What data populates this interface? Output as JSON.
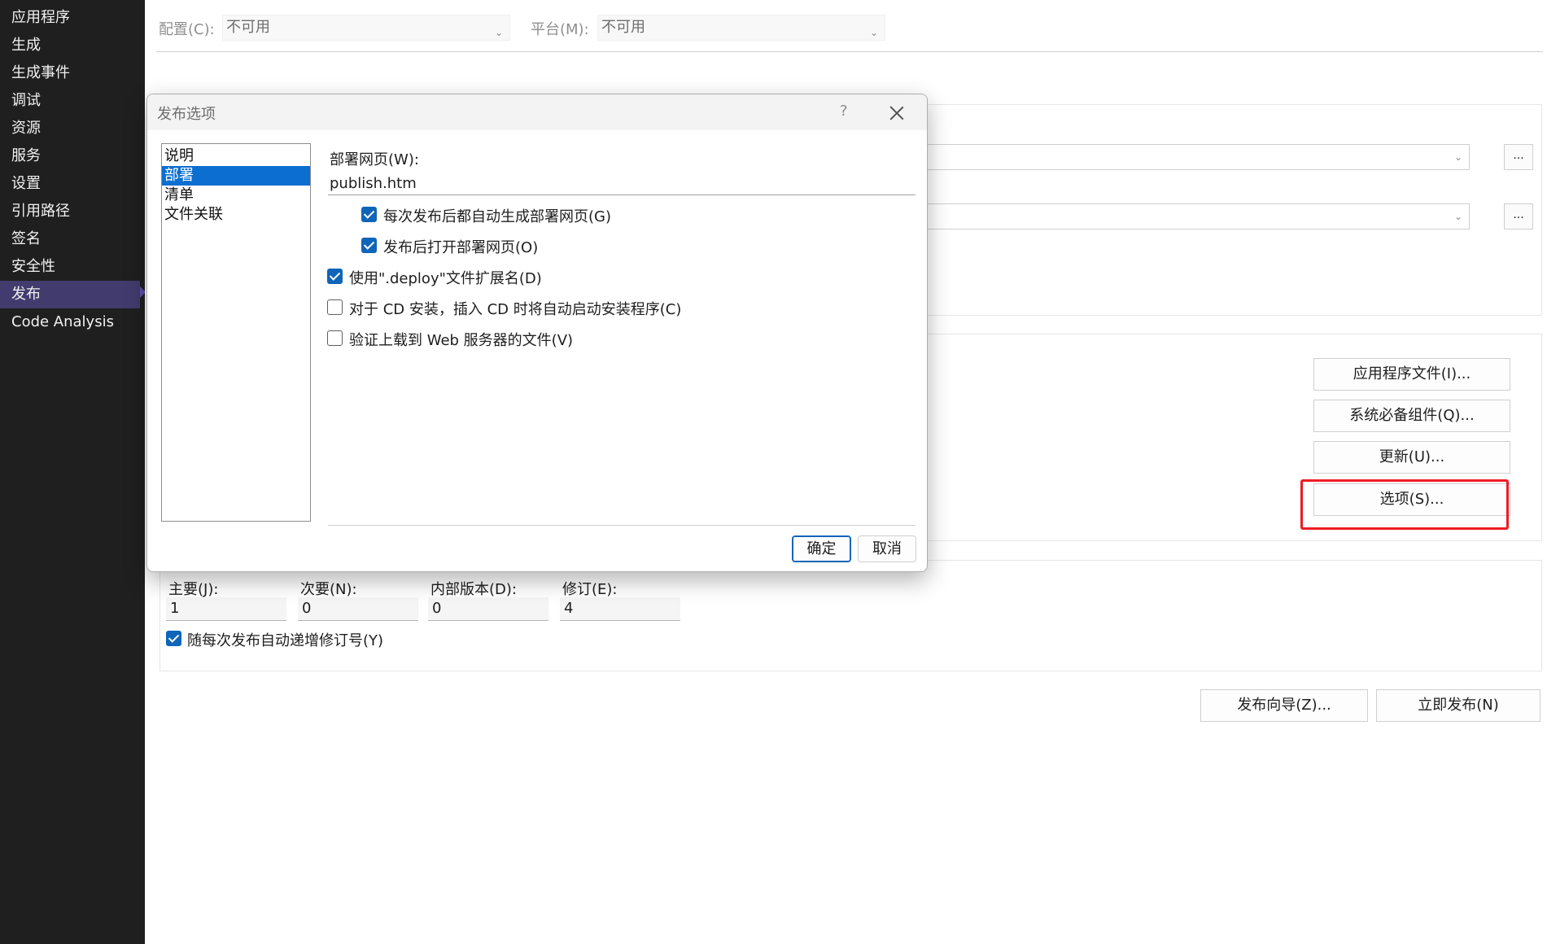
{
  "sidebar": {
    "items": [
      {
        "label": "应用程序"
      },
      {
        "label": "生成"
      },
      {
        "label": "生成事件"
      },
      {
        "label": "调试"
      },
      {
        "label": "资源"
      },
      {
        "label": "服务"
      },
      {
        "label": "设置"
      },
      {
        "label": "引用路径"
      },
      {
        "label": "签名"
      },
      {
        "label": "安全性"
      },
      {
        "label": "发布",
        "selected": true
      },
      {
        "label": "Code Analysis"
      }
    ]
  },
  "toolbar": {
    "config_label": "配置(C):",
    "config_value": "不可用",
    "platform_label": "平台(M):",
    "platform_value": "不可用"
  },
  "install": {
    "buttons": {
      "app_files": "应用程序文件(I)...",
      "prerequisites": "系统必备组件(Q)...",
      "updates": "更新(U)...",
      "options": "选项(S)..."
    }
  },
  "version": {
    "major_label": "主要(J):",
    "major": "1",
    "minor_label": "次要(N):",
    "minor": "0",
    "build_label": "内部版本(D):",
    "build": "0",
    "revision_label": "修订(E):",
    "revision": "4",
    "auto_increment_label": "随每次发布自动递增修订号(Y)",
    "auto_increment_checked": true
  },
  "footer": {
    "wizard_button": "发布向导(Z)...",
    "publish_now_button": "立即发布(N)"
  },
  "more_button": "...",
  "dialog": {
    "title": "发布选项",
    "help": "?",
    "categories": [
      {
        "label": "说明",
        "selected": false
      },
      {
        "label": "部署",
        "selected": true
      },
      {
        "label": "清单",
        "selected": false
      },
      {
        "label": "文件关联",
        "selected": false
      }
    ],
    "deploy_page_label": "部署网页(W):",
    "deploy_page_value": "publish.htm",
    "options": [
      {
        "label": "每次发布后都自动生成部署网页(G)",
        "checked": true
      },
      {
        "label": "发布后打开部署网页(O)",
        "checked": true
      },
      {
        "label": "使用\".deploy\"文件扩展名(D)",
        "checked": true
      },
      {
        "label": "对于 CD 安装，插入 CD 时将自动启动安装程序(C)",
        "checked": false
      },
      {
        "label": "验证上载到 Web 服务器的文件(V)",
        "checked": false
      }
    ],
    "ok_button": "确定",
    "cancel_button": "取消"
  },
  "colors": {
    "sidebar_bg": "#1f1f1f",
    "sidebar_selected": "#413c6d",
    "accent": "#0f65b8",
    "highlight_box": "#ee1c24"
  }
}
